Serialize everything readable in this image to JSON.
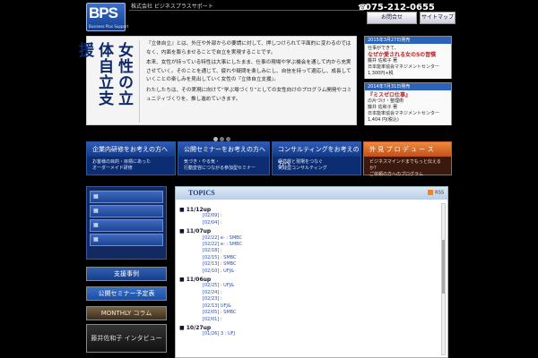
{
  "header": {
    "logo": "BPS",
    "logo_sub": "Business Plus Support",
    "company": "株式会社 ビジネスプラスサポート",
    "phone": "075-212-0655",
    "contact_btn": "お問合せ",
    "sitemap_btn": "サイトマップ"
  },
  "hero": {
    "vertical_title": "女性の立体自立支援",
    "paragraphs": [
      "『立体自立』とは、外圧や外部からの要請に対して、押しつけられて平面的に変わるのではなく、内面を膨らませることで自立を実現することです。",
      "本来、女性が持っている特性は大事にしたまま、仕事の現場や学ぶ機会を通して内から充実させていく。そのことを通じて、疲れや疑問を楽しみにし、自信を持って適応し、成長していくことの楽しみを見出していく女性の『立体自立支援』。",
      "わたしたちは、その実現に向けて“学ぶ場づくり”としての女性向けのプログラム開発やコミュニティづくりを、推し進めていきます。"
    ]
  },
  "ads": [
    {
      "date": "2015年3月27日発売",
      "lines": [
        "仕事ができて、",
        "なぜか愛される女の5の習慣",
        "藤井 佐和子 著",
        "日本能率協会マネジメントセンター",
        "1,300円+税"
      ]
    },
    {
      "date": "2014年7月31日発売",
      "lines": [
        "『ミスゼロ仕事』",
        "の片づけ・整理術",
        "藤井 佐和子 著",
        "日本能率協会マネジメントセンター",
        "1,404 円(税込)"
      ]
    }
  ],
  "nav": [
    {
      "title": "企業内研修をお考えの方へ",
      "sub": [
        "お客様の目的・目標にあった",
        "オーダーメイド研修"
      ]
    },
    {
      "title": "公開セミナーをお考えの方へ",
      "sub": [
        "気づき・やる気・",
        "行動変容につながる参加型セミナー"
      ]
    },
    {
      "title": "コンサルティングをお考えの方へ",
      "sub": [
        "経営層と現場をつなぐ",
        "実践型コンサルティング"
      ]
    },
    {
      "title": "外 見 プ ロ デ ュ ー ス",
      "sub": [
        "ビジネスマインドまでもっと伝えるか？",
        "ご依頼の方へのプログラム"
      ]
    }
  ],
  "sidebar": {
    "buttons": [
      "支援事例",
      "公開セミナー予定表",
      "MONTHLY コラム",
      "藤井佐和子 インタビュー"
    ]
  },
  "topics": {
    "title": "TOPICS",
    "rss": "RSS",
    "groups": [
      {
        "date": "11/12up",
        "items": [
          "[02/09] :",
          "[02/04] :"
        ]
      },
      {
        "date": "11/07up",
        "items": [
          "[02/22] e- : SMBC",
          "[02/22] e- : SMBC",
          "[02/18] :",
          "[02/15] : SMBC",
          "[02/13] : SMBC",
          "[02/10] : UFJ&"
        ]
      },
      {
        "date": "11/06up",
        "items": [
          "[02/25] : UFJ&",
          "[02/24] :",
          "[02/23] :",
          "[02/13] UFJ&",
          "[02/05] : SMBC",
          "[02/01] :"
        ]
      },
      {
        "date": "10/27up",
        "items": [
          "[01/26] 3 : UFJ"
        ]
      }
    ]
  }
}
